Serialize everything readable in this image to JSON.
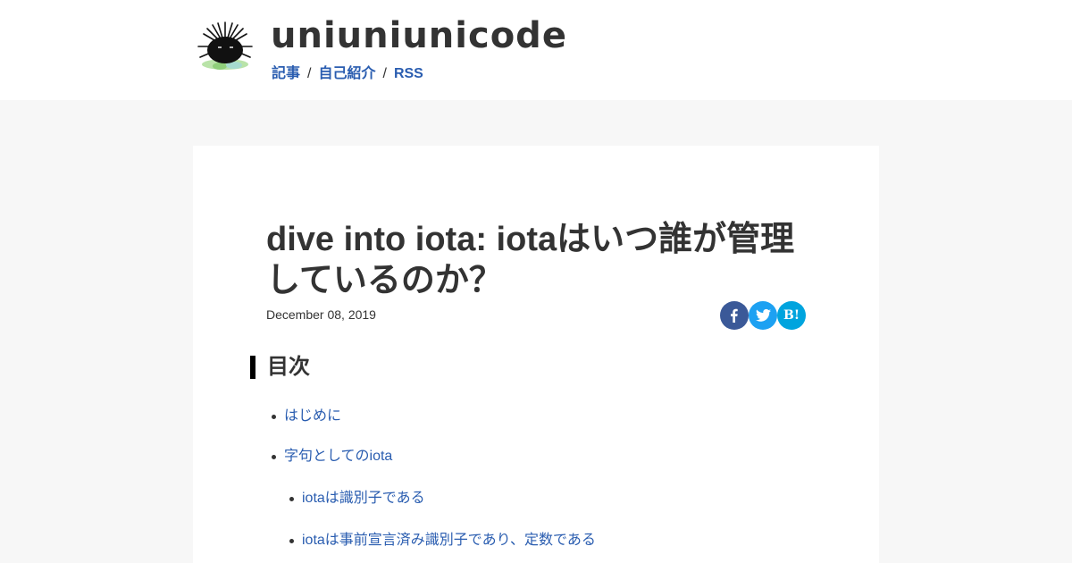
{
  "site": {
    "title": "uniuniunicode",
    "logo_icon": "sea-urchin-icon",
    "nav": [
      {
        "label": "記事"
      },
      {
        "label": "自己紹介"
      },
      {
        "label": "RSS"
      }
    ],
    "nav_separator": "/"
  },
  "post": {
    "title": "dive into iota: iotaはいつ誰が管理しているのか？",
    "date": "December 08, 2019"
  },
  "share": [
    {
      "icon": "facebook-icon",
      "color": "#3b5998"
    },
    {
      "icon": "twitter-icon",
      "color": "#1da1f2"
    },
    {
      "icon": "hatena-bookmark-icon",
      "label": "B!",
      "color": "#00a4de"
    }
  ],
  "toc": {
    "heading": "目次",
    "items": [
      {
        "label": "はじめに",
        "level": 1
      },
      {
        "label": "字句としてのiota",
        "level": 1
      },
      {
        "label": "iotaは識別子である",
        "level": 2
      },
      {
        "label": "iotaは事前宣言済み識別子であり、定数である",
        "level": 2
      }
    ]
  },
  "colors": {
    "link": "#2a5db0",
    "page_background": "#f7f7f7",
    "card_background": "#ffffff",
    "text": "#333333"
  }
}
